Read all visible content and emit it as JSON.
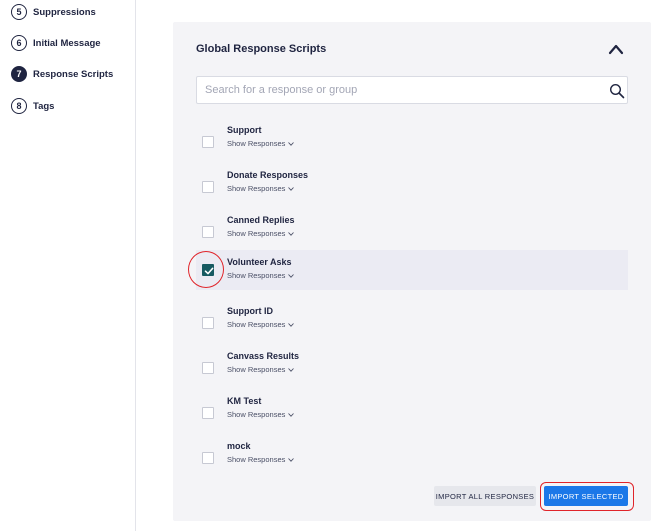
{
  "sidebar": {
    "steps": [
      {
        "number": "5",
        "label": "Suppressions"
      },
      {
        "number": "6",
        "label": "Initial Message"
      },
      {
        "number": "7",
        "label": "Response Scripts"
      },
      {
        "number": "8",
        "label": "Tags"
      }
    ]
  },
  "panel": {
    "title": "Global Response Scripts",
    "search_placeholder": "Search for a response or group",
    "search_value": "",
    "show_responses_label": "Show Responses",
    "groups": [
      {
        "label": "Support",
        "checked": false
      },
      {
        "label": "Donate Responses",
        "checked": false
      },
      {
        "label": "Canned Replies",
        "checked": false
      },
      {
        "label": "Volunteer Asks",
        "checked": true
      },
      {
        "label": "Support ID",
        "checked": false
      },
      {
        "label": "Canvass Results",
        "checked": false
      },
      {
        "label": "KM Test",
        "checked": false
      },
      {
        "label": "mock",
        "checked": false
      }
    ],
    "import_all_label": "IMPORT ALL RESPONSES",
    "import_selected_label": "IMPORT SELECTED"
  },
  "colors": {
    "accent": "#1b78e8",
    "checkbox_checked": "#165a61",
    "highlight_ring": "#e0242a"
  }
}
